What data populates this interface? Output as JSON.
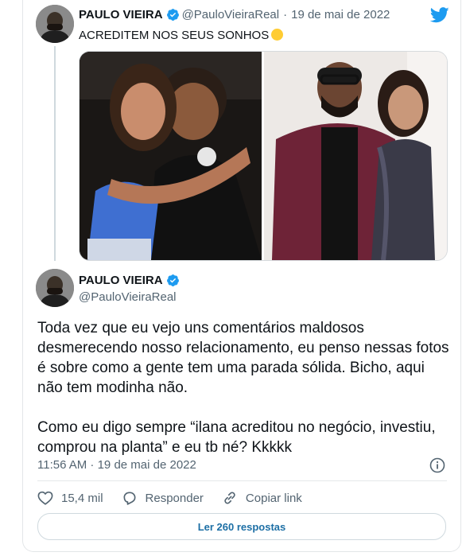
{
  "first_tweet": {
    "author_name": "PAULO VIEIRA",
    "handle": "@PauloVieiraReal",
    "separator": "·",
    "date": "19 de mai de 2022",
    "text": "ACREDITEM NOS SEUS SONHOS",
    "emoji": "laughing-emoji",
    "photos": [
      "photo-couple-party",
      "photo-couple-formal"
    ]
  },
  "main_tweet": {
    "author_name": "PAULO VIEIRA",
    "handle": "@PauloVieiraReal",
    "paragraph_1": "Toda vez que eu vejo uns comentários maldosos desmerecendo nosso relacionamento, eu penso nessas fotos é sobre como a gente tem uma parada sólida. Bicho, aqui não tem modinha não.",
    "paragraph_2": "Como eu digo sempre “ilana acreditou no negócio, investiu, comprou na planta” e eu tb né? Kkkkk",
    "time": "11:56 AM · 19 de mai de 2022"
  },
  "actions": {
    "likes": "15,4 mil",
    "reply_label": "Responder",
    "copy_link_label": "Copiar link"
  },
  "replies_button_label": "Ler 260 respostas",
  "colors": {
    "twitter_blue": "#1d9bf0",
    "link_blue": "#1d6fa5",
    "secondary_text": "#536471",
    "border": "#cfd9de"
  },
  "icons": [
    "verified-badge-icon",
    "twitter-bird-icon",
    "info-icon",
    "heart-icon",
    "reply-icon",
    "link-icon"
  ]
}
